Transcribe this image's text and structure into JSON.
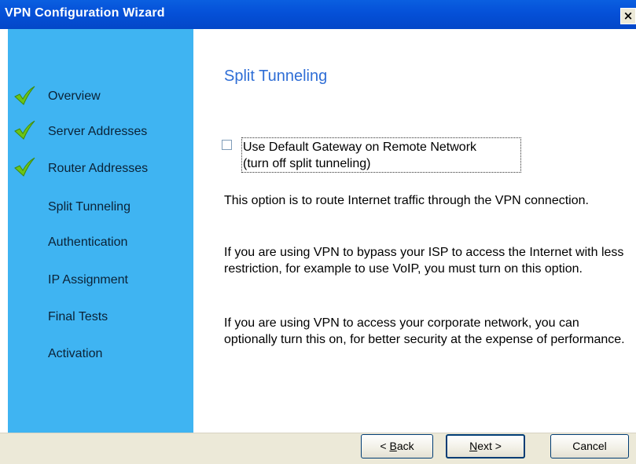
{
  "window": {
    "title": "VPN Configuration Wizard",
    "close_glyph": "×"
  },
  "sidebar": {
    "steps": [
      {
        "label": "Overview",
        "completed": true
      },
      {
        "label": "Server Addresses",
        "completed": true
      },
      {
        "label": "Router Addresses",
        "completed": true
      },
      {
        "label": "Split Tunneling",
        "completed": false,
        "current": true
      },
      {
        "label": "Authentication",
        "completed": false
      },
      {
        "label": "IP Assignment",
        "completed": false
      },
      {
        "label": "Final Tests",
        "completed": false
      },
      {
        "label": "Activation",
        "completed": false
      }
    ],
    "check_icon": "green-checkmark-icon"
  },
  "main": {
    "heading": "Split Tunneling",
    "checkbox": {
      "checked": false,
      "line1": "Use Default Gateway on Remote Network",
      "line2": "(turn off split tunneling)"
    },
    "paragraphs": [
      "This option is to route Internet traffic through the VPN connection.",
      "If you are using VPN to bypass your ISP to access the Internet with less restriction, for example to use VoIP, you must turn on this option.",
      "If you are using VPN to access your corporate network, you can optionally turn this on, for better security at the expense of performance."
    ]
  },
  "buttons": {
    "back": {
      "pre": "< ",
      "mnemonic": "B",
      "post": "ack"
    },
    "next": {
      "pre": "",
      "mnemonic": "N",
      "post": "ext >"
    },
    "cancel": "Cancel"
  },
  "colors": {
    "titlebar": "#0550d8",
    "sidebar": "#3fb4f2",
    "heading": "#2f6ed6"
  }
}
